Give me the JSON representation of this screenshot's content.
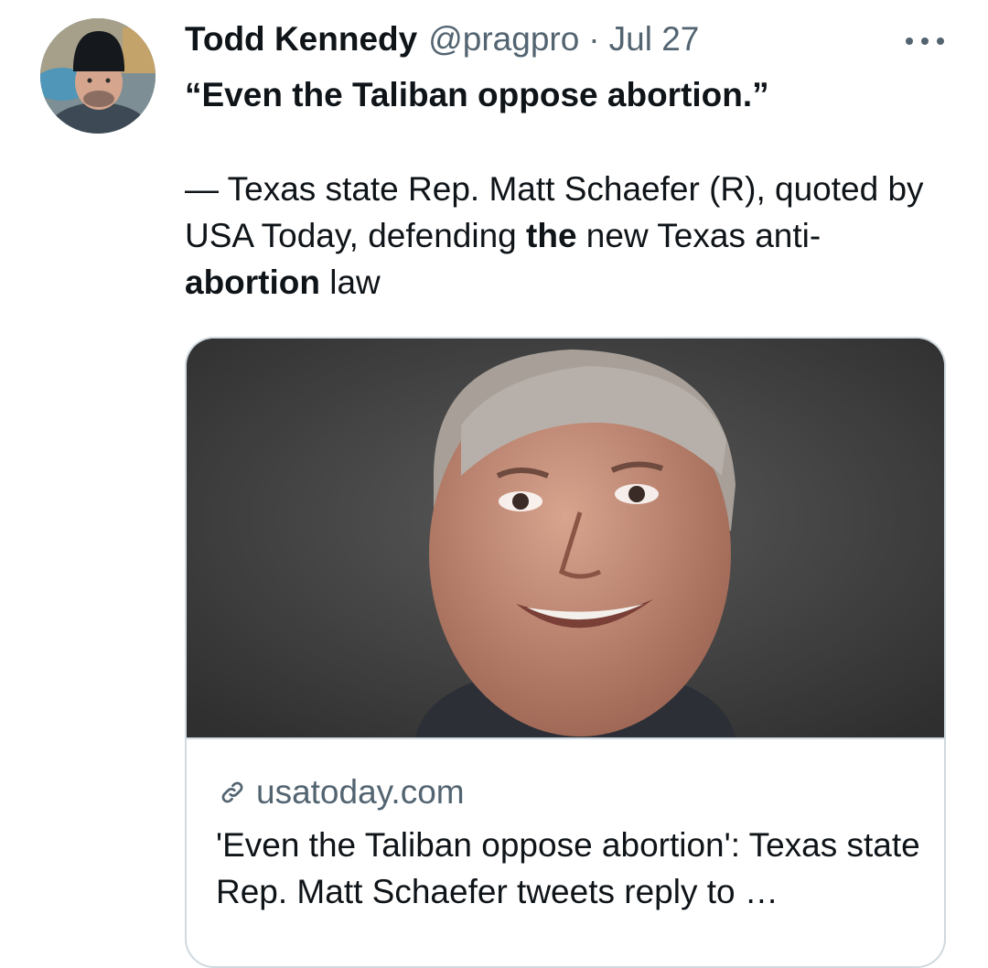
{
  "tweet": {
    "author_name": "Todd Kennedy",
    "handle": "@pragpro",
    "separator": "·",
    "date": "Jul 27",
    "more_icon": "more-horizontal-icon",
    "text": {
      "quote": "“Even the Taliban oppose abortion.”",
      "attribution_1": "— Texas state Rep. Matt Schaefer (R), quoted by USA Today, defending ",
      "attribution_bold_1": "the",
      "attribution_2": " new Texas anti-",
      "attribution_bold_2": "abortion",
      "attribution_3": " law"
    }
  },
  "card": {
    "link_icon": "link-icon",
    "domain": "usatoday.com",
    "title": "'Even the Taliban oppose abortion': Texas state Rep. Matt Schaefer tweets reply to …"
  },
  "colors": {
    "text_primary": "#0f1419",
    "text_secondary": "#536471",
    "border": "#cfd9de"
  }
}
